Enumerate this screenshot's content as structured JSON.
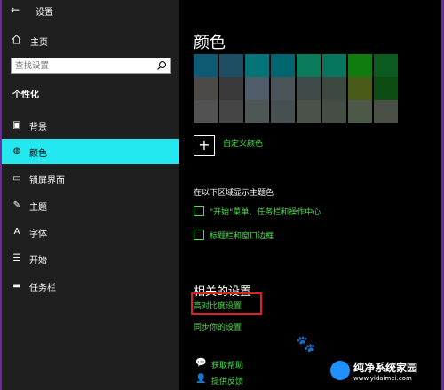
{
  "window": {
    "title": "设置",
    "back_glyph": "←"
  },
  "sidebar": {
    "home_label": "主页",
    "search_placeholder": "查找设置",
    "section_title": "个性化",
    "items": [
      {
        "label": "背景",
        "icon": "image-icon",
        "glyph": "▣"
      },
      {
        "label": "颜色",
        "icon": "palette-icon",
        "glyph": "◍",
        "active": true
      },
      {
        "label": "锁屏界面",
        "icon": "lock-screen-icon",
        "glyph": "▭"
      },
      {
        "label": "主题",
        "icon": "theme-icon",
        "glyph": "✎"
      },
      {
        "label": "字体",
        "icon": "font-icon",
        "glyph": "A"
      },
      {
        "label": "开始",
        "icon": "start-icon",
        "glyph": "☰"
      },
      {
        "label": "任务栏",
        "icon": "taskbar-icon",
        "glyph": "▬"
      }
    ]
  },
  "main": {
    "title": "颜色",
    "swatches": [
      [
        "#0f5a73",
        "#1e4e63",
        "#047478",
        "#00656e",
        "#0a7a5a",
        "#08765f",
        "#107c10",
        "#0b5a1f"
      ],
      [
        "#4c4a48",
        "#3a3a3a",
        "#515c6b",
        "#4a5459",
        "#3f4b4b",
        "#3d4840",
        "#4a5a18",
        "#0b4d13"
      ],
      [
        "#525252",
        "#454545",
        "#4f5656",
        "#475050",
        "#4b5249",
        "#464d45",
        "#4c5848",
        "#4a4f47"
      ]
    ],
    "custom_color_label": "自定义颜色",
    "show_accent_label": "在以下区域显示主题色",
    "checkboxes": [
      {
        "label": "\"开始\"菜单、任务栏和操作中心",
        "checked": false
      },
      {
        "label": "标题栏和窗口边框",
        "checked": false
      }
    ],
    "related_title": "相关的设置",
    "related_links": [
      "高对比度设置",
      "同步你的设置"
    ],
    "help_links": [
      {
        "label": "获取帮助",
        "icon": "help-icon"
      },
      {
        "label": "提供反馈",
        "icon": "feedback-icon"
      }
    ]
  },
  "watermark": {
    "name": "纯净系统家园",
    "url": "www.yidaimei.com"
  }
}
